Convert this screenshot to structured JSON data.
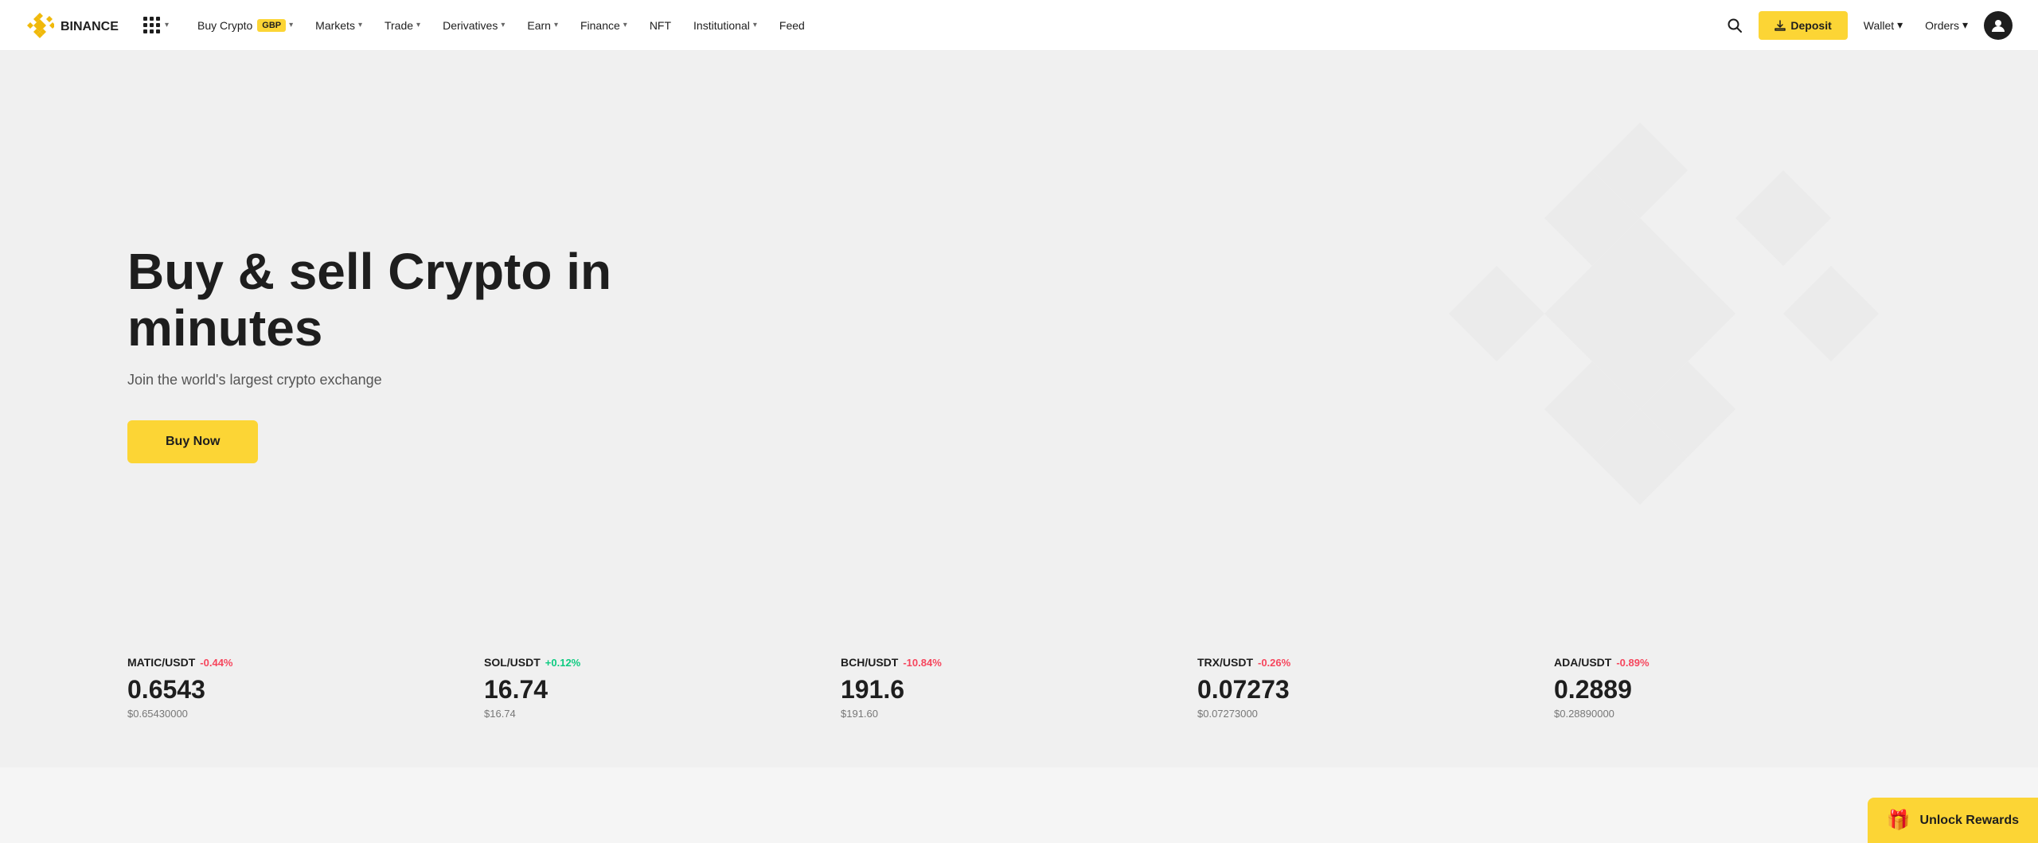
{
  "brand": {
    "name": "BINANCE",
    "logo_color": "#F0B90B"
  },
  "navbar": {
    "grid_label": "grid-menu",
    "nav_items": [
      {
        "label": "Buy Crypto",
        "badge": "GBP",
        "has_dropdown": true
      },
      {
        "label": "Markets",
        "has_dropdown": true
      },
      {
        "label": "Trade",
        "has_dropdown": true
      },
      {
        "label": "Derivatives",
        "has_dropdown": true
      },
      {
        "label": "Earn",
        "has_dropdown": true
      },
      {
        "label": "Finance",
        "has_dropdown": true
      },
      {
        "label": "NFT",
        "has_dropdown": false
      },
      {
        "label": "Institutional",
        "has_dropdown": true
      },
      {
        "label": "Feed",
        "has_dropdown": false
      }
    ],
    "deposit_label": "Deposit",
    "wallet_label": "Wallet",
    "orders_label": "Orders"
  },
  "hero": {
    "title": "Buy & sell Crypto in minutes",
    "subtitle": "Join the world's largest crypto exchange",
    "cta_label": "Buy Now"
  },
  "ticker": {
    "items": [
      {
        "pair": "MATIC/USDT",
        "change": "-0.44%",
        "change_type": "neg",
        "price": "0.6543",
        "usd": "$0.65430000"
      },
      {
        "pair": "SOL/USDT",
        "change": "+0.12%",
        "change_type": "pos",
        "price": "16.74",
        "usd": "$16.74"
      },
      {
        "pair": "BCH/USDT",
        "change": "-10.84%",
        "change_type": "neg",
        "price": "191.6",
        "usd": "$191.60"
      },
      {
        "pair": "TRX/USDT",
        "change": "-0.26%",
        "change_type": "neg",
        "price": "0.07273",
        "usd": "$0.07273000"
      },
      {
        "pair": "ADA/USDT",
        "change": "-0.89%",
        "change_type": "neg",
        "price": "0.2889",
        "usd": "$0.28890000"
      }
    ]
  },
  "unlock_rewards": {
    "label": "Unlock Rewards"
  }
}
